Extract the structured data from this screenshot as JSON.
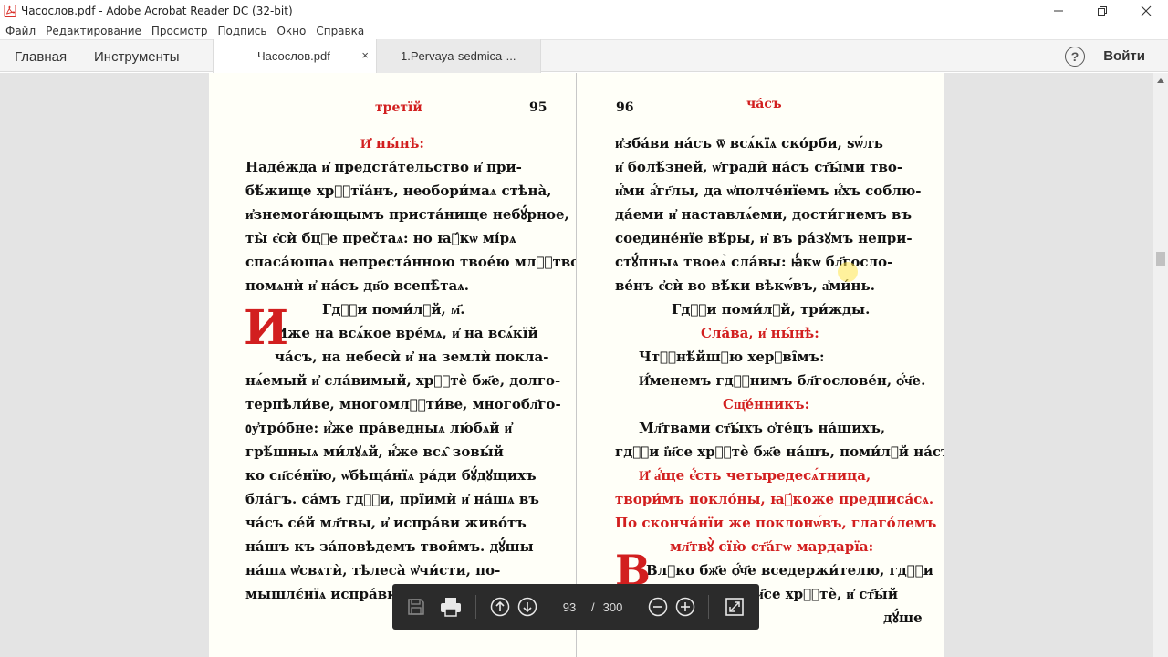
{
  "window": {
    "title": "Часослов.pdf - Adobe Acrobat Reader DC (32-bit)"
  },
  "menu": [
    "Файл",
    "Редактирование",
    "Просмотр",
    "Подпись",
    "Окно",
    "Справка"
  ],
  "tabs": {
    "home": "Главная",
    "tools": "Инструменты",
    "doc_active": "Часослов.pdf",
    "doc_inactive": "1.Pervaya-sedmica-...",
    "close": "×",
    "help": "?",
    "signin": "Войти"
  },
  "left_page": {
    "header_word": "третїй",
    "page_number": "95",
    "lines": [
      {
        "text": "И҆ ны́нѣ:",
        "red": true
      },
      {
        "text": "Наде́жда и҆ предста́тельство и҆ при-"
      },
      {
        "text": "бѣ́жище хрⷭ҇тїа́нъ, необори́маѧ стѣна̀,"
      },
      {
        "text": "и҆знемога́ющымъ приста́нище небꙋ́рное,"
      },
      {
        "text": "ты̀ є҆сѝ бцⷣе прečтаѧ: но ꙗ҆́кѡ мі́рѧ"
      },
      {
        "text": "спаса́ющаѧ непреста́нною твое́ю млⷭ҇твою,"
      },
      {
        "text": "помѧнѝ и҆ на́съ дв҃о всепѣ̑таѧ."
      },
      {
        "text": "Гдⷭ҇и поми́лꙋй, м҃."
      },
      {
        "text": "Иже на всѧ́кое вре́мѧ, и҆ на всѧ́кїй"
      },
      {
        "text": "ча́съ, на небесѝ и҆ на землѝ покла-"
      },
      {
        "text": "нѧ́емый и҆ сла́вимый, хрⷭ҇тѐ бж҃е, долго-"
      },
      {
        "text": "терпѣли́ве, многомлⷭ҇ти́ве, многобл҃го-"
      },
      {
        "text": "ᲂу҆тро́бне: и҆́же пра́ведныѧ лю́бѧй и҆"
      },
      {
        "text": "грѣ́шныѧ ми́лꙋѧй, и҆́же всѧ̑ зовы́й"
      },
      {
        "text": "ко сп҃се́нїю, ѡ҆бѣща́нїѧ ра́ди бꙋ́дꙋщихъ"
      },
      {
        "text": "бла́гъ. са́мъ гдⷭ҇и, прїимѝ и҆ на́шѧ въ"
      },
      {
        "text": "ча́съ се́й мл҃твы, и҆ испра́ви живо́тъ"
      },
      {
        "text": "на́шъ къ за́повѣдемъ твои̑мъ. дꙋ́шы"
      },
      {
        "text": "на́шѧ ѡ҆свѧтѝ, тѣлеса̀ ѡ҆чи́сти, по-"
      },
      {
        "text": "мышлє́нїѧ испра́ви,"
      }
    ]
  },
  "right_page": {
    "page_number": "96",
    "header_word": "ча́съ",
    "lines": [
      {
        "text": "и҆зба́ви на́съ ѿ всѧ́кїѧ ско́рби, ѕѡ́лъ"
      },
      {
        "text": "и҆ болѣ́зней, ѡ҆гради̑ на́съ ст҃ы́ми тво-"
      },
      {
        "text": "и҆́ми а҆́гг҃лы, да ѡ҆полче́нїемъ и҆́хъ соблю-"
      },
      {
        "text": "да́еми и҆ наставлѧ́еми, дости́гнемъ въ"
      },
      {
        "text": "соедине́нїе вѣ́ры, и҆ въ ра́зꙋмъ непри-"
      },
      {
        "text": "стꙋ́пныѧ твоеѧ̀ сла́вы: ꙗ҆́кѡ бл҃госло-"
      },
      {
        "text": "ве́нъ є҆сѝ во вѣ́ки вѣкѡ́въ, а҆ми́нь."
      },
      {
        "text": "Гдⷭ҇и поми́лꙋй, три́жды."
      },
      {
        "text": "Сла́ва, и҆ ны́нѣ:",
        "red": true
      },
      {
        "text": "Чтⷭ҇нѣ́йшꙋю херꙋві̑мъ:"
      },
      {
        "text": "И҆́менемъ гдⷭ҇нимъ бл҃гослове́н, ѻ҆́ч҃е."
      },
      {
        "text": "Сщ҃е́нникъ:",
        "red": true
      },
      {
        "text": "Мл҃твами ст҃ы́хъ ѻ҆те́цъ на́шихъ,"
      },
      {
        "text": "гдⷭ҇и і҆и҃се хрⷭ҇тѐ бж҃е на́шъ, поми́лꙋй на́съ."
      },
      {
        "text": "И҆ а҆́ще є҆́сть четыредесѧ́тница,",
        "red": true
      },
      {
        "text": "твори́мъ покло́ны, ꙗ҆́коже предписа́сѧ.",
        "red": true
      },
      {
        "text": "По сконча́нїи же поклонѡ́въ, глаго́лемъ",
        "red": true
      },
      {
        "text": "мл҃твꙋ̀ сїю̀ ст҃а́гѡ мардарїа:",
        "red": true
      },
      {
        "text": "Влⷣко бж҃е ѻ҆́ч҃е вседержи́телю, гдⷭ҇и"
      },
      {
        "text": "і҆и҃се хрⷭ҇тѐ, и҆ ст҃ы́й"
      },
      {
        "text": "дꙋ́ше"
      }
    ]
  },
  "toolbar": {
    "current_page": "93",
    "separator": "/",
    "total_pages": "300"
  },
  "colors": {
    "accent_red": "#d21f1f",
    "toolbar_bg": "#2b2b2b",
    "doc_bg": "#e4e4e4"
  }
}
